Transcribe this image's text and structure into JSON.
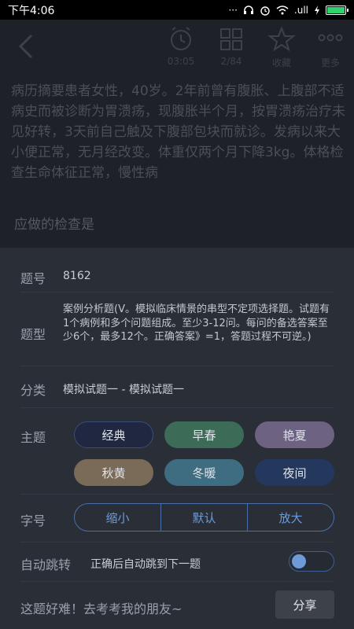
{
  "status_bar": {
    "time": "下午4:06",
    "dots": "···",
    "network": ".ull"
  },
  "toolbar": {
    "timer_label": "03:05",
    "progress_label": "2/84",
    "favorite_label": "收藏",
    "more_label": "更多"
  },
  "question": {
    "case_text": "病历摘要患者女性，40岁。2年前曾有腹胀、上腹部不适病史而被诊断为胃溃疡，现腹胀半个月，按胃溃疡治疗未见好转，3天前自己触及下腹部包块而就诊。发病以来大小便正常，无月经改变。体重仅两个月下降3kg。体格检查生命体征正常，慢性病",
    "prompt": "应做的检查是"
  },
  "panel": {
    "id_label": "题号",
    "id_value": "8162",
    "type_label": "题型",
    "type_value": "案例分析题(V。模拟临床情景的串型不定项选择题。试题有1个病例和多个问题组成。至少3-12问。每问的备选答案至少6个，最多12个。正确答案》=1，答题过程不可逆。)",
    "category_label": "分类",
    "category_value": "模拟试题一 - 模拟试题一",
    "theme_label": "主题",
    "themes": [
      {
        "label": "经典",
        "color": "#1f2840",
        "border": "#3a4d7a"
      },
      {
        "label": "早春",
        "color": "#3c6b58",
        "border": "#3c6b58"
      },
      {
        "label": "艳夏",
        "color": "#6e6282",
        "border": "#6e6282"
      },
      {
        "label": "秋黄",
        "color": "#7a6a58",
        "border": "#7a6a58"
      },
      {
        "label": "冬暖",
        "color": "#3e6c80",
        "border": "#3e6c80"
      },
      {
        "label": "夜间",
        "color": "#24385e",
        "border": "#24385e"
      }
    ],
    "font_label": "字号",
    "font_options": [
      "缩小",
      "默认",
      "放大"
    ],
    "autojump_label": "自动跳转",
    "autojump_desc": "正确后自动跳到下一题",
    "autojump_on": false,
    "share_prompt": "这题好难！去考考我的朋友~",
    "share_button": "分享"
  },
  "colors": {
    "accent": "#6f9ad8",
    "panel_bg": "#2a2e36",
    "toggle_border": "#3f5f94"
  }
}
